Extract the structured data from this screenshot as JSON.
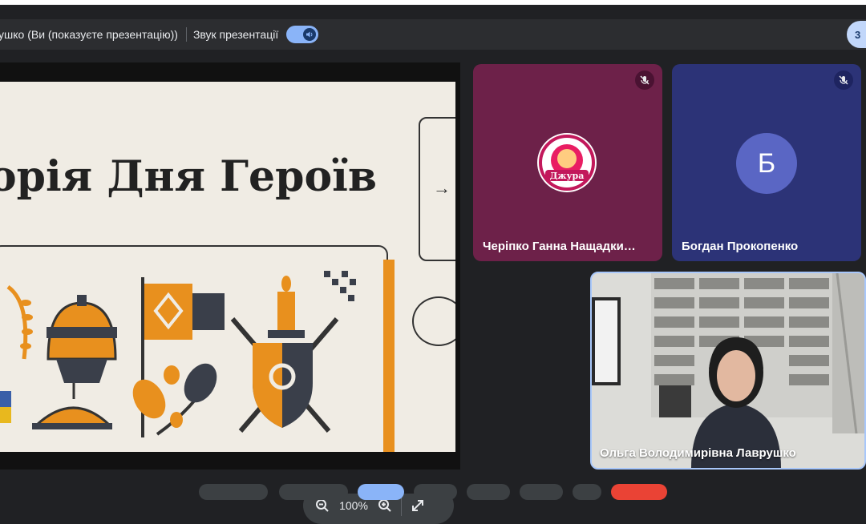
{
  "presentation_bar": {
    "presenter_text": "ушко (Ви (показуєте презентацію))",
    "sound_label": "Звук презентації",
    "sound_toggle_on": true,
    "corner_badge": "3"
  },
  "slide": {
    "title": "орія Дня Героїв",
    "arrow_glyph": "→"
  },
  "zoom": {
    "zoom_out_icon": "zoom-out-icon",
    "level": "100%",
    "zoom_in_icon": "zoom-in-icon",
    "fullscreen_icon": "fullscreen-icon"
  },
  "participants": [
    {
      "name": "Черіпко Ганна Нащадки…",
      "muted": true,
      "avatar_type": "logo",
      "logo_text": "Джура",
      "tile_color": "#6d2149"
    },
    {
      "name": "Богдан Прокопенко",
      "muted": true,
      "avatar_type": "initial",
      "initial": "Б",
      "tile_color": "#2c3377"
    },
    {
      "name": "Ольга Володимирівна Лаврушко",
      "muted": false,
      "avatar_type": "video",
      "active_speaker": true
    }
  ],
  "colors": {
    "accent": "#8ab4f8",
    "slide_background": "#f0ece4",
    "slide_orange": "#e8901e"
  }
}
